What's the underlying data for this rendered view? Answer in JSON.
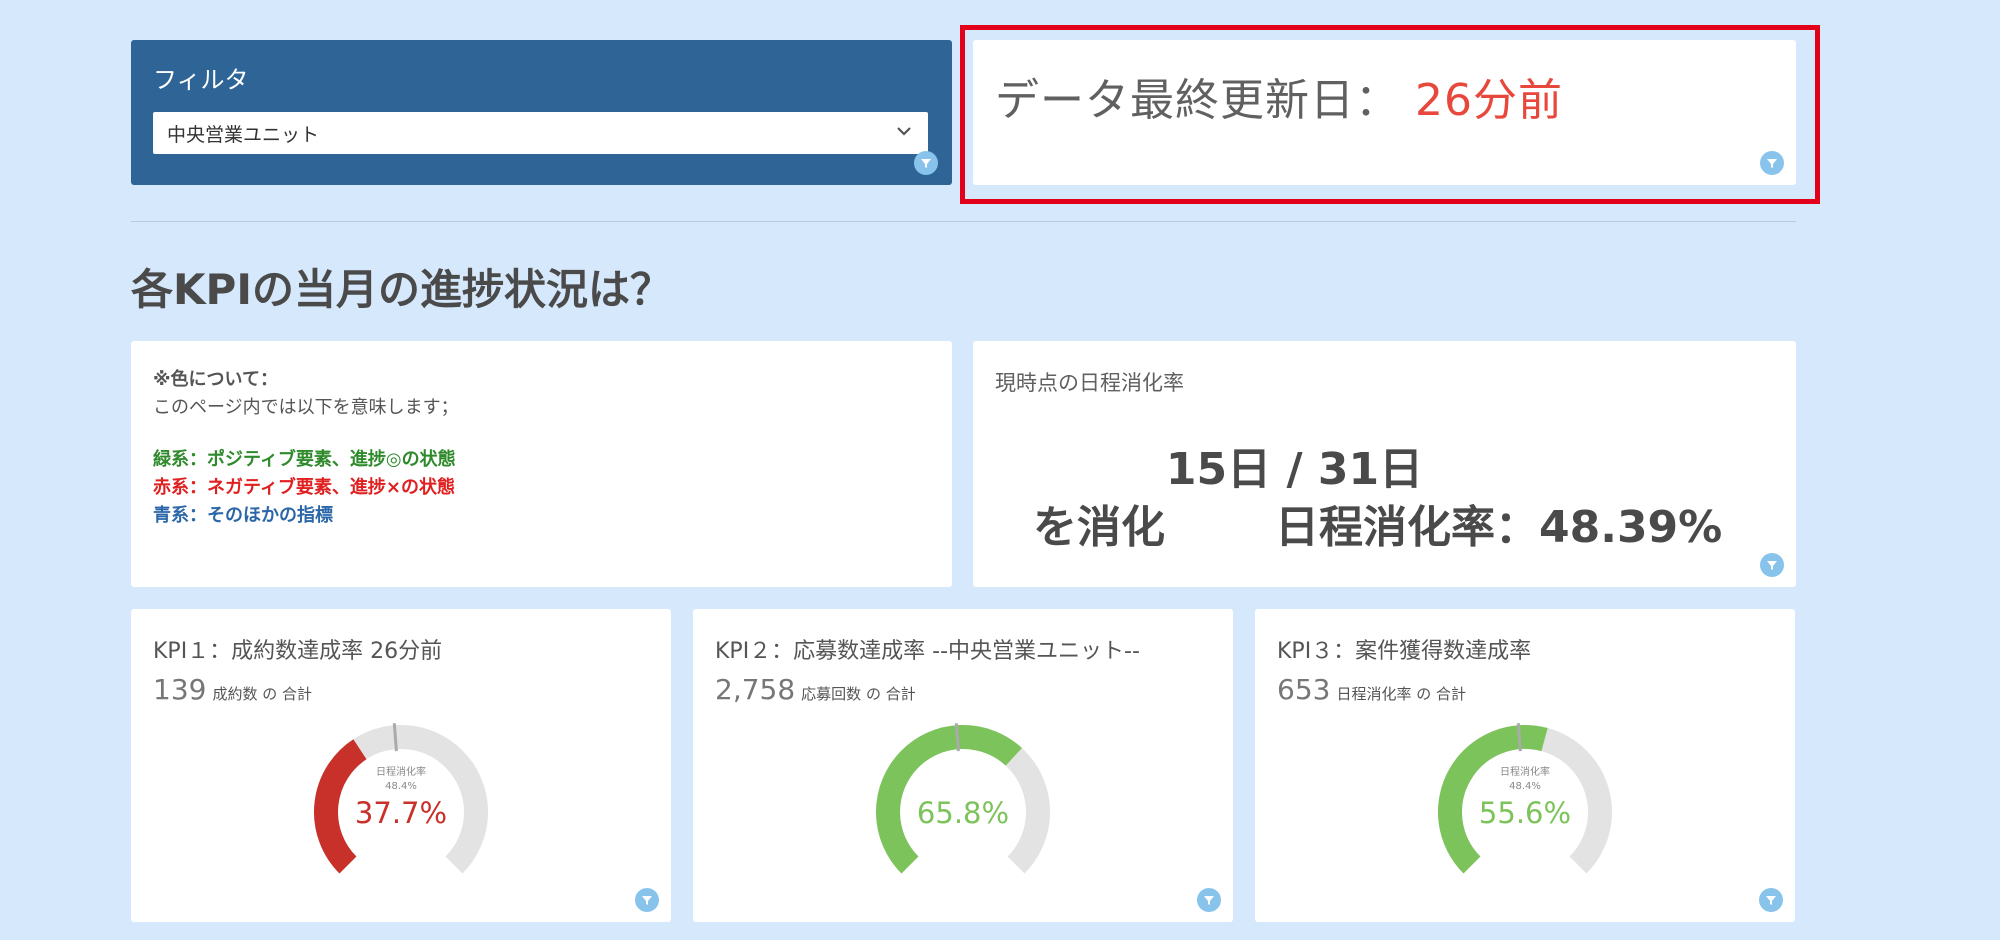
{
  "filter": {
    "title": "フィルタ",
    "selected": "中央営業ユニット"
  },
  "update": {
    "label": "データ最終更新日：",
    "value": "26分前"
  },
  "section_title": "各KPIの当月の進捗状況は？",
  "legend": {
    "heading": "※色について：",
    "subheading": "このページ内では以下を意味します；",
    "green": "緑系：ポジティブ要素、進捗◎の状態",
    "red": "赤系：ネガティブ要素、進捗×の状態",
    "blue": "青系：そのほかの指標"
  },
  "schedule": {
    "title": "現時点の日程消化率",
    "days": "15日 / 31日",
    "consumed": "を消化",
    "rate": "日程消化率：48.39%"
  },
  "colors": {
    "negative": "#c8302a",
    "positive": "#7dc35b",
    "track": "#e3e3e3",
    "panel": "#2e6596",
    "highlight": "#e2001a"
  },
  "kpis": [
    {
      "title": "KPI１：成約数達成率 26分前",
      "total": "139",
      "unit": "成約数 の 合計",
      "marker_label": "日程消化率",
      "marker_value": "48.4%",
      "percent_text": "37.7%",
      "percent": 37.7,
      "marker": 48.4,
      "status": "negative",
      "show_marker_text": true
    },
    {
      "title": "KPI２：応募数達成率 --中央営業ユニット--",
      "total": "2,758",
      "unit": "応募回数 の 合計",
      "marker_label": "",
      "marker_value": "",
      "percent_text": "65.8%",
      "percent": 65.8,
      "marker": 48.4,
      "status": "positive",
      "show_marker_text": false
    },
    {
      "title": "KPI３：案件獲得数達成率",
      "total": "653",
      "unit": "日程消化率 の 合計",
      "marker_label": "日程消化率",
      "marker_value": "48.4%",
      "percent_text": "55.6%",
      "percent": 55.6,
      "marker": 48.4,
      "status": "positive",
      "show_marker_text": true
    }
  ]
}
